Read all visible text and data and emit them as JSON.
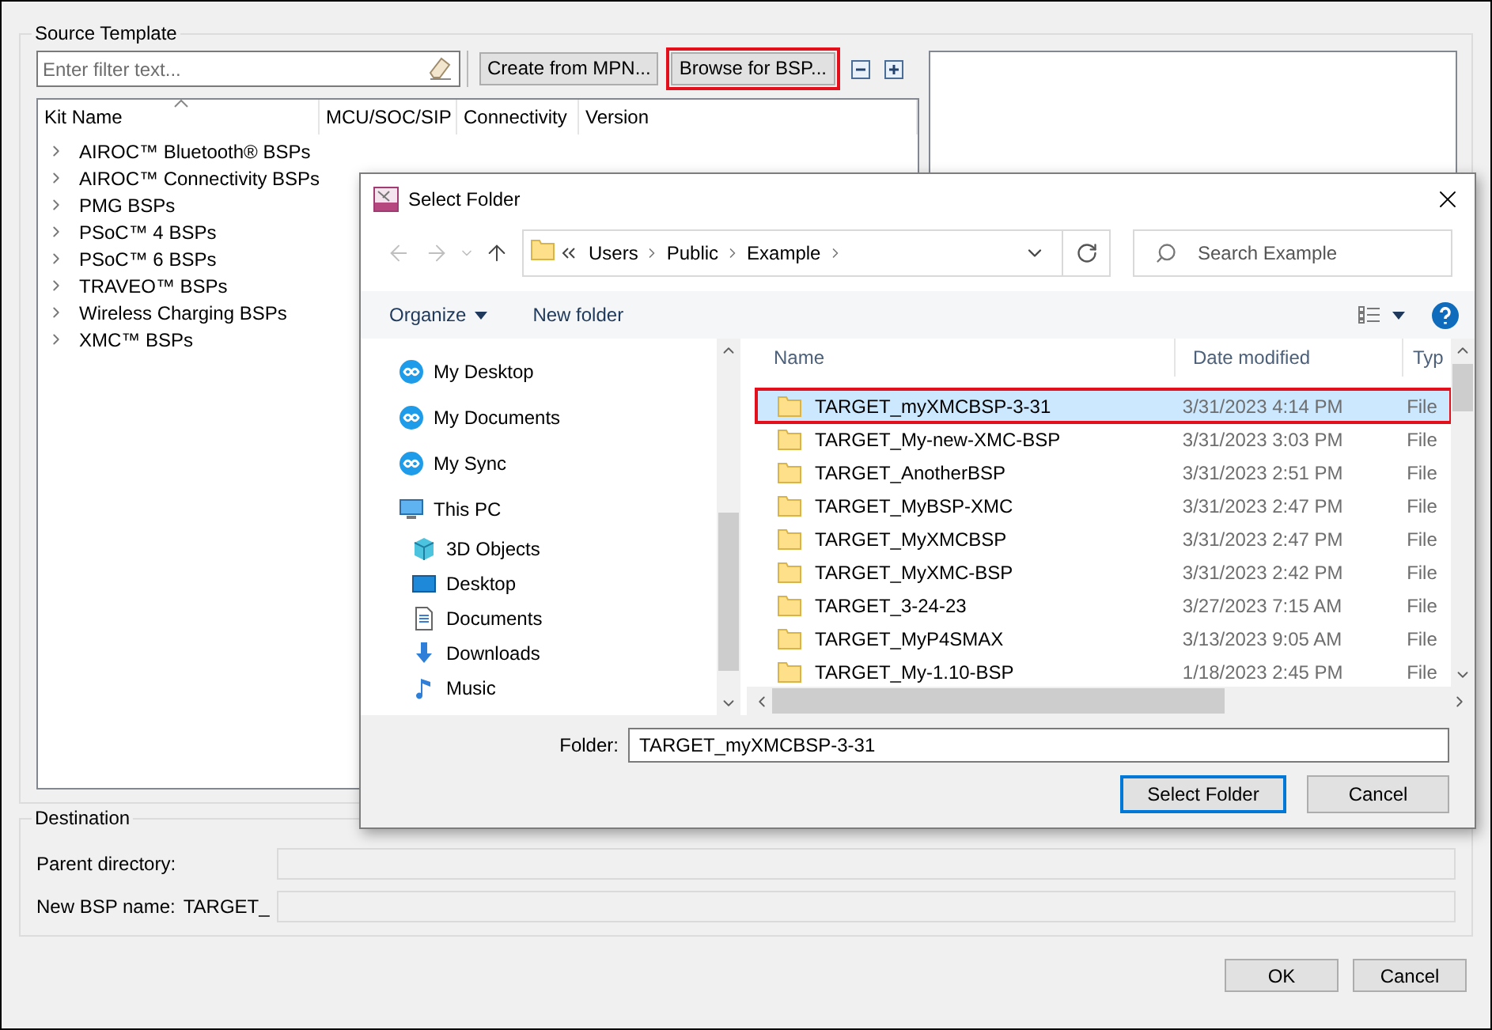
{
  "source_template": {
    "title": "Source Template",
    "filter": {
      "placeholder": "Enter filter text..."
    },
    "buttons": [
      {
        "label": "Create from MPN...",
        "highlighted": false
      },
      {
        "label": "Browse for BSP...",
        "highlighted": true
      }
    ],
    "tree": {
      "columns": [
        "Kit Name",
        "MCU/SOC/SIP",
        "Connectivity",
        "Version"
      ],
      "items": [
        {
          "label": "AIROC™ Bluetooth® BSPs",
          "expanded": false
        },
        {
          "label": "AIROC™ Connectivity BSPs",
          "expanded": false
        },
        {
          "label": "PMG BSPs",
          "expanded": false
        },
        {
          "label": "PSoC™ 4 BSPs",
          "expanded": false
        },
        {
          "label": "PSoC™ 6 BSPs",
          "expanded": false
        },
        {
          "label": "TRAVEO™ BSPs",
          "expanded": false
        },
        {
          "label": "Wireless Charging BSPs",
          "expanded": false
        },
        {
          "label": "XMC™ BSPs",
          "expanded": false
        }
      ]
    }
  },
  "destination": {
    "title": "Destination",
    "fields": [
      {
        "label": "Parent directory:"
      },
      {
        "label": "New BSP name:",
        "prefix": "TARGET_"
      }
    ]
  },
  "buttons": [
    "OK",
    "Cancel"
  ],
  "dialog": {
    "title": "Select Folder",
    "breadcrumb": [
      "Users",
      "Public",
      "Example"
    ],
    "search": {
      "placeholder": "Search Example"
    },
    "toolbar": {
      "organize": "Organize",
      "new_folder": "New folder"
    },
    "nav": [
      {
        "label": "My Desktop",
        "kind": "cloud"
      },
      {
        "label": "My Documents",
        "kind": "cloud"
      },
      {
        "label": "My Sync",
        "kind": "cloud"
      },
      {
        "label": "This PC",
        "kind": "pc",
        "children": [
          {
            "label": "3D Objects",
            "kind": "cube"
          },
          {
            "label": "Desktop",
            "kind": "desktop"
          },
          {
            "label": "Documents",
            "kind": "document"
          },
          {
            "label": "Downloads",
            "kind": "download"
          },
          {
            "label": "Music",
            "kind": "music"
          }
        ]
      }
    ],
    "columns": [
      "Name",
      "Date modified",
      "Typ"
    ],
    "rows": [
      {
        "name": "TARGET_myXMCBSP-3-31",
        "date": "3/31/2023 4:14 PM",
        "type": "File",
        "selected": true,
        "highlighted": true
      },
      {
        "name": "TARGET_My-new-XMC-BSP",
        "date": "3/31/2023 3:03 PM",
        "type": "File",
        "selected": false,
        "highlighted": false
      },
      {
        "name": "TARGET_AnotherBSP",
        "date": "3/31/2023 2:51 PM",
        "type": "File",
        "selected": false,
        "highlighted": false
      },
      {
        "name": "TARGET_MyBSP-XMC",
        "date": "3/31/2023 2:47 PM",
        "type": "File",
        "selected": false,
        "highlighted": false
      },
      {
        "name": "TARGET_MyXMCBSP",
        "date": "3/31/2023 2:47 PM",
        "type": "File",
        "selected": false,
        "highlighted": false
      },
      {
        "name": "TARGET_MyXMC-BSP",
        "date": "3/31/2023 2:42 PM",
        "type": "File",
        "selected": false,
        "highlighted": false
      },
      {
        "name": "TARGET_3-24-23",
        "date": "3/27/2023 7:15 AM",
        "type": "File",
        "selected": false,
        "highlighted": false
      },
      {
        "name": "TARGET_MyP4SMAX",
        "date": "3/13/2023 9:05 AM",
        "type": "File",
        "selected": false,
        "highlighted": false
      },
      {
        "name": "TARGET_My-1.10-BSP",
        "date": "1/18/2023 2:45 PM",
        "type": "File",
        "selected": false,
        "highlighted": false
      }
    ],
    "folder": {
      "label": "Folder:",
      "value": "TARGET_myXMCBSP-3-31"
    },
    "buttons": [
      {
        "label": "Select Folder",
        "default": true
      },
      {
        "label": "Cancel",
        "default": false
      }
    ]
  }
}
